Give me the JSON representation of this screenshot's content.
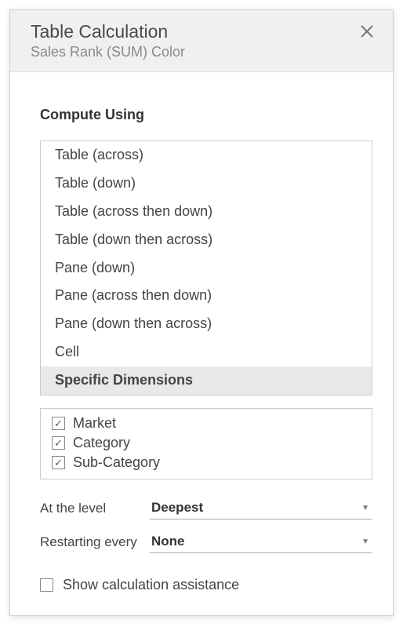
{
  "header": {
    "title": "Table Calculation",
    "subtitle": "Sales Rank (SUM) Color"
  },
  "section": {
    "compute_using": "Compute Using"
  },
  "compute_options": {
    "0": "Table (across)",
    "1": "Table (down)",
    "2": "Table (across then down)",
    "3": "Table (down then across)",
    "4": "Pane (down)",
    "5": "Pane (across then down)",
    "6": "Pane (down then across)",
    "7": "Cell",
    "8": "Specific Dimensions"
  },
  "dimensions": {
    "0": "Market",
    "1": "Category",
    "2": "Sub-Category"
  },
  "at_level": {
    "label": "At the level",
    "value": "Deepest"
  },
  "restarting": {
    "label": "Restarting every",
    "value": "None"
  },
  "show_assistance": {
    "label": "Show calculation assistance"
  }
}
